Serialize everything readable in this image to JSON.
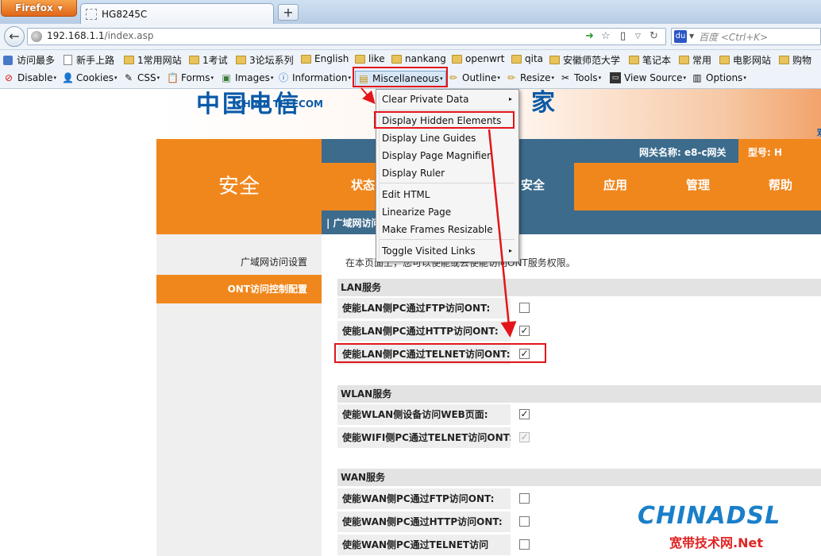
{
  "browser": {
    "menu_button": "Firefox",
    "tab_title": "HG8245C",
    "new_tab_symbol": "+",
    "url_host": "192.168.1.1",
    "url_path": "/index.asp",
    "search_placeholder": "百度 <Ctrl+K>"
  },
  "bookmarks": [
    {
      "label": "访问最多",
      "icon": "search-icon"
    },
    {
      "label": "新手上路",
      "icon": "page-icon"
    },
    {
      "label": "1常用网站",
      "icon": "folder-icon"
    },
    {
      "label": "1考试",
      "icon": "folder-icon"
    },
    {
      "label": "3论坛系列",
      "icon": "folder-icon"
    },
    {
      "label": "English",
      "icon": "folder-icon"
    },
    {
      "label": "like",
      "icon": "folder-icon"
    },
    {
      "label": "nankang",
      "icon": "folder-icon"
    },
    {
      "label": "openwrt",
      "icon": "folder-icon"
    },
    {
      "label": "qita",
      "icon": "folder-icon"
    },
    {
      "label": "安徽师范大学",
      "icon": "folder-icon"
    },
    {
      "label": "笔记本",
      "icon": "folder-icon"
    },
    {
      "label": "常用",
      "icon": "folder-icon"
    },
    {
      "label": "电影网站",
      "icon": "folder-icon"
    },
    {
      "label": "购物",
      "icon": "folder-icon"
    }
  ],
  "devtoolbar": {
    "disable": "Disable",
    "cookies": "Cookies",
    "css": "CSS",
    "forms": "Forms",
    "images": "Images",
    "information": "Information",
    "miscellaneous": "Miscellaneous",
    "outline": "Outline",
    "resize": "Resize",
    "tools": "Tools",
    "view_source": "View Source",
    "options": "Options"
  },
  "menu": {
    "items": [
      {
        "label": "Clear Private Data",
        "submenu": true
      },
      {
        "label": "Display Hidden Elements",
        "submenu": false
      },
      {
        "label": "Display Line Guides",
        "submenu": false
      },
      {
        "label": "Display Page Magnifier",
        "submenu": false
      },
      {
        "label": "Display Ruler",
        "submenu": false
      },
      {
        "label": "Edit HTML",
        "submenu": false
      },
      {
        "label": "Linearize Page",
        "submenu": false
      },
      {
        "label": "Make Frames Resizable",
        "submenu": false
      },
      {
        "label": "Toggle Visited Links",
        "submenu": true
      }
    ],
    "submenu_arrow": "▸"
  },
  "router": {
    "logo_cn": "中国电信",
    "logo_en": "CHINA TELECOM",
    "banner_right": "家",
    "banner_edge": "欢",
    "section_title": "安全",
    "gateway_name": "网关名称: e8-c网关",
    "model_label": "型号: H",
    "nav_tabs": [
      {
        "label": "状态"
      },
      {
        "label": "安全"
      },
      {
        "label": "应用"
      },
      {
        "label": "管理"
      },
      {
        "label": "帮助"
      }
    ],
    "subnav": "| 广域网访问设置 |",
    "sidebar": {
      "wan_access": "广域网访问设置",
      "ont_access": "ONT访问控制配置"
    },
    "intro": "在本页面上，您可以使能或去使能访问ONT服务权限。",
    "sections": [
      {
        "title": "LAN服务",
        "rows": [
          {
            "label": "使能LAN侧PC通过FTP访问ONT:",
            "checked": false,
            "disabled": false
          },
          {
            "label": "使能LAN侧PC通过HTTP访问ONT:",
            "checked": true,
            "disabled": false
          },
          {
            "label": "使能LAN侧PC通过TELNET访问ONT:",
            "checked": true,
            "disabled": false
          }
        ]
      },
      {
        "title": "WLAN服务",
        "rows": [
          {
            "label": "使能WLAN侧设备访问WEB页面:",
            "checked": true,
            "disabled": false
          },
          {
            "label": "使能WIFI侧PC通过TELNET访问ONT:",
            "checked": true,
            "disabled": true
          }
        ]
      },
      {
        "title": "WAN服务",
        "rows": [
          {
            "label": "使能WAN侧PC通过FTP访问ONT:",
            "checked": false,
            "disabled": false
          },
          {
            "label": "使能WAN侧PC通过HTTP访问ONT:",
            "checked": false,
            "disabled": false
          },
          {
            "label": "使能WAN侧PC通过TELNET访问",
            "checked": false,
            "disabled": false
          }
        ]
      }
    ],
    "check_mark": "✓"
  },
  "watermark": {
    "top": "CHINADSL",
    "bottom": "宽带技术网.Net"
  },
  "colors": {
    "accent_orange": "#f0871d",
    "nav_blue": "#3c6b8c",
    "annotation_red": "#e3151a"
  }
}
